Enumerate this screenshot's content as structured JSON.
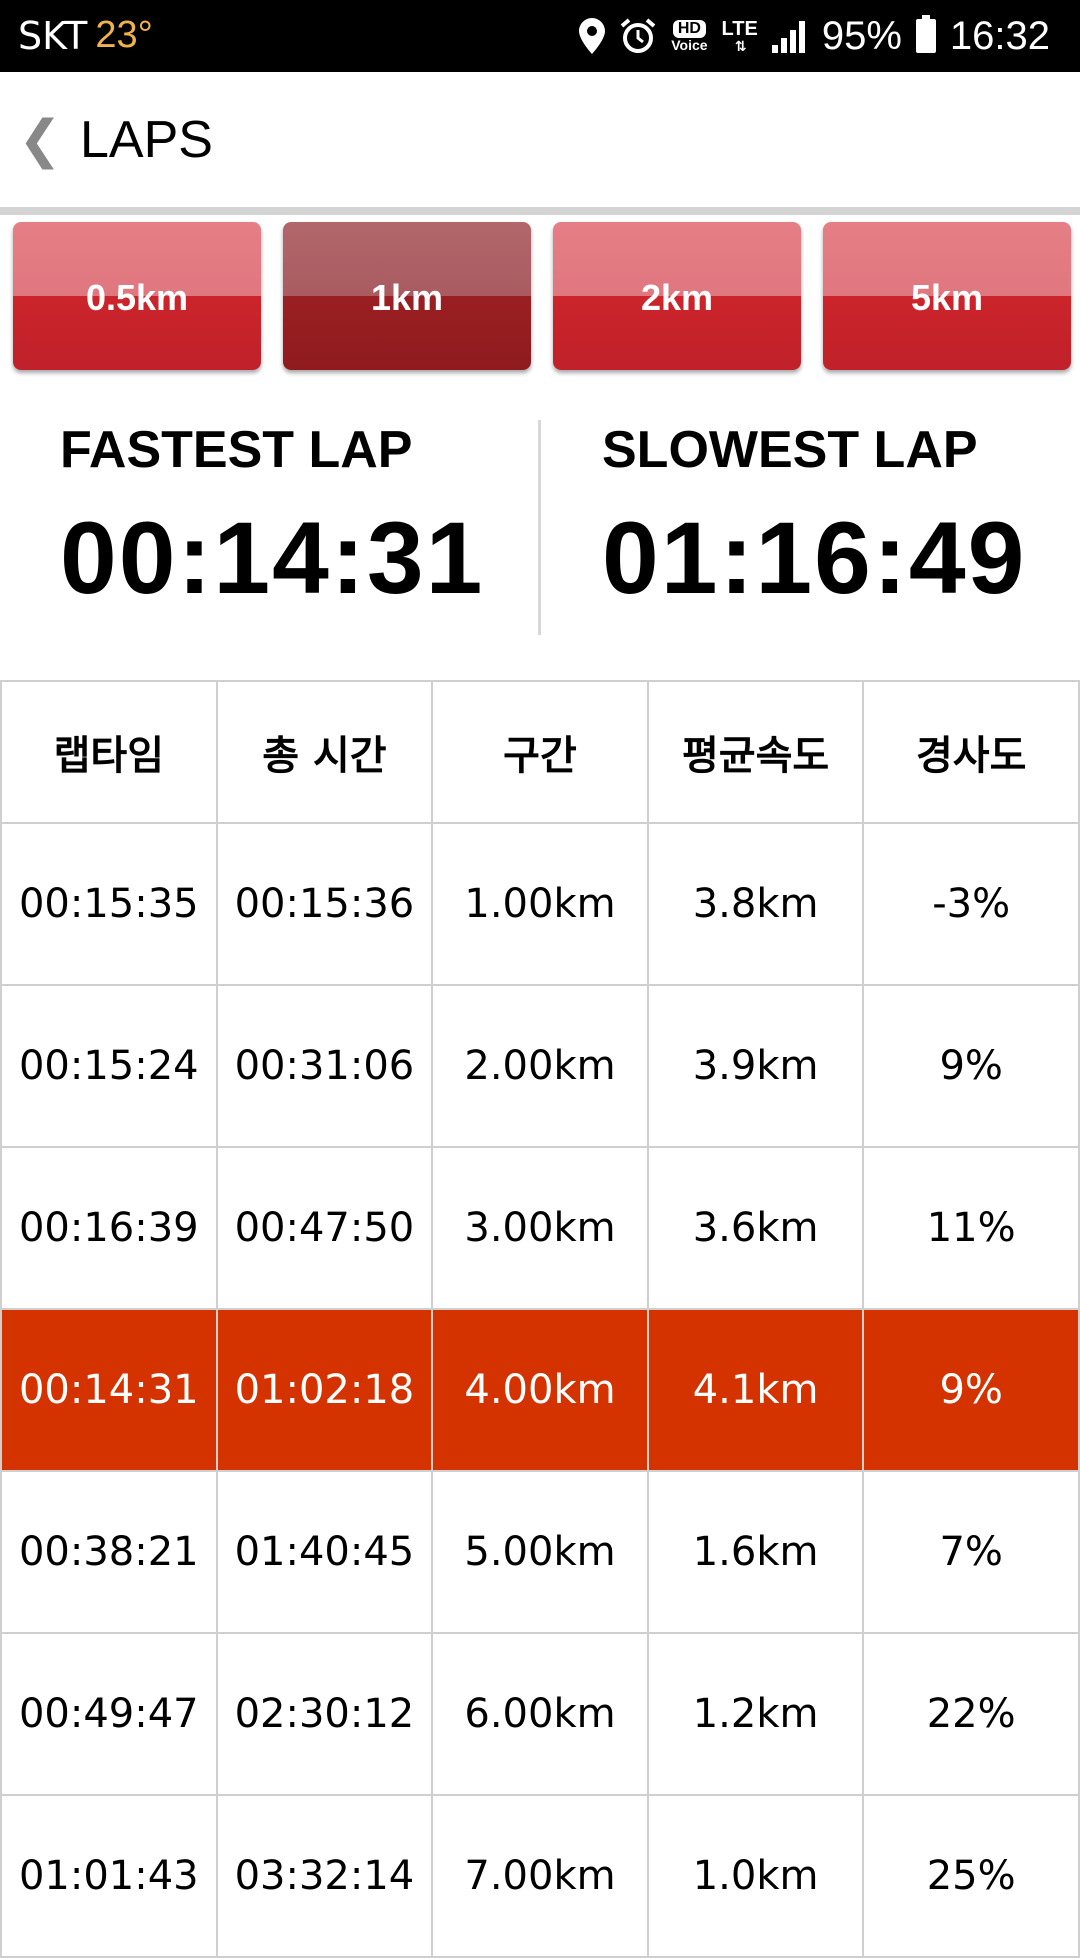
{
  "status_bar": {
    "carrier": "SKT",
    "temperature": "23°",
    "icons": [
      "location-icon",
      "alarm-icon",
      "hd-voice-icon",
      "lte-icon",
      "signal-icon",
      "battery-icon"
    ],
    "hd_label": "HD",
    "voice_label": "Voice",
    "lte_label": "LTE",
    "battery": "95%",
    "time": "16:32"
  },
  "header": {
    "back_glyph": "❮",
    "title": "LAPS"
  },
  "segments": [
    {
      "label": "0.5km",
      "active": false
    },
    {
      "label": "1km",
      "active": true
    },
    {
      "label": "2km",
      "active": false
    },
    {
      "label": "5km",
      "active": false
    }
  ],
  "stats": {
    "fastest": {
      "label": "FASTEST LAP",
      "value": "00:14:31"
    },
    "slowest": {
      "label": "SLOWEST LAP",
      "value": "01:16:49"
    }
  },
  "table": {
    "headers": [
      "랩타임",
      "총 시간",
      "구간",
      "평균속도",
      "경사도"
    ],
    "rows": [
      [
        "00:15:35",
        "00:15:36",
        "1.00km",
        "3.8km",
        "-3%"
      ],
      [
        "00:15:24",
        "00:31:06",
        "2.00km",
        "3.9km",
        "9%"
      ],
      [
        "00:16:39",
        "00:47:50",
        "3.00km",
        "3.6km",
        "11%"
      ],
      [
        "00:14:31",
        "01:02:18",
        "4.00km",
        "4.1km",
        "9%"
      ],
      [
        "00:38:21",
        "01:40:45",
        "5.00km",
        "1.6km",
        "7%"
      ],
      [
        "00:49:47",
        "02:30:12",
        "6.00km",
        "1.2km",
        "22%"
      ],
      [
        "01:01:43",
        "03:32:14",
        "7.00km",
        "1.0km",
        "25%"
      ]
    ],
    "highlight_row": 3
  },
  "colors": {
    "highlight": "#d43300",
    "button_red": "#c0212a",
    "button_active": "#8f1b1f"
  }
}
